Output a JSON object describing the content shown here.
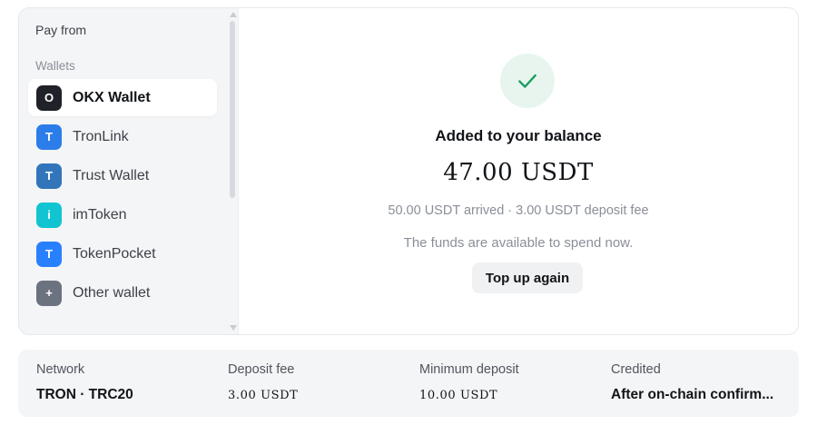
{
  "sidebar": {
    "title": "Pay from",
    "section_label": "Wallets",
    "wallets": [
      {
        "initial": "O",
        "name": "OKX Wallet",
        "color": "#1f2329",
        "selected": true
      },
      {
        "initial": "T",
        "name": "TronLink",
        "color": "#2b7de9"
      },
      {
        "initial": "T",
        "name": "Trust Wallet",
        "color": "#3375bb"
      },
      {
        "initial": "i",
        "name": "imToken",
        "color": "#11c4d1"
      },
      {
        "initial": "T",
        "name": "TokenPocket",
        "color": "#2980fe"
      },
      {
        "initial": "+",
        "name": "Other wallet",
        "color": "#6b7280"
      }
    ]
  },
  "status": {
    "icon": "check-icon",
    "title": "Added to your balance",
    "amount": "47.00 USDT",
    "detail": "50.00 USDT arrived · 3.00 USDT deposit fee",
    "info": "The funds are available to spend now.",
    "button_label": "Top up again",
    "accent": "#1a9d5f"
  },
  "summary": [
    {
      "label": "Network",
      "value": "TRON · TRC20"
    },
    {
      "label": "Deposit fee",
      "value": "3.00 USDT"
    },
    {
      "label": "Minimum deposit",
      "value": "10.00 USDT"
    },
    {
      "label": "Credited",
      "value": "After on-chain confirm..."
    }
  ]
}
